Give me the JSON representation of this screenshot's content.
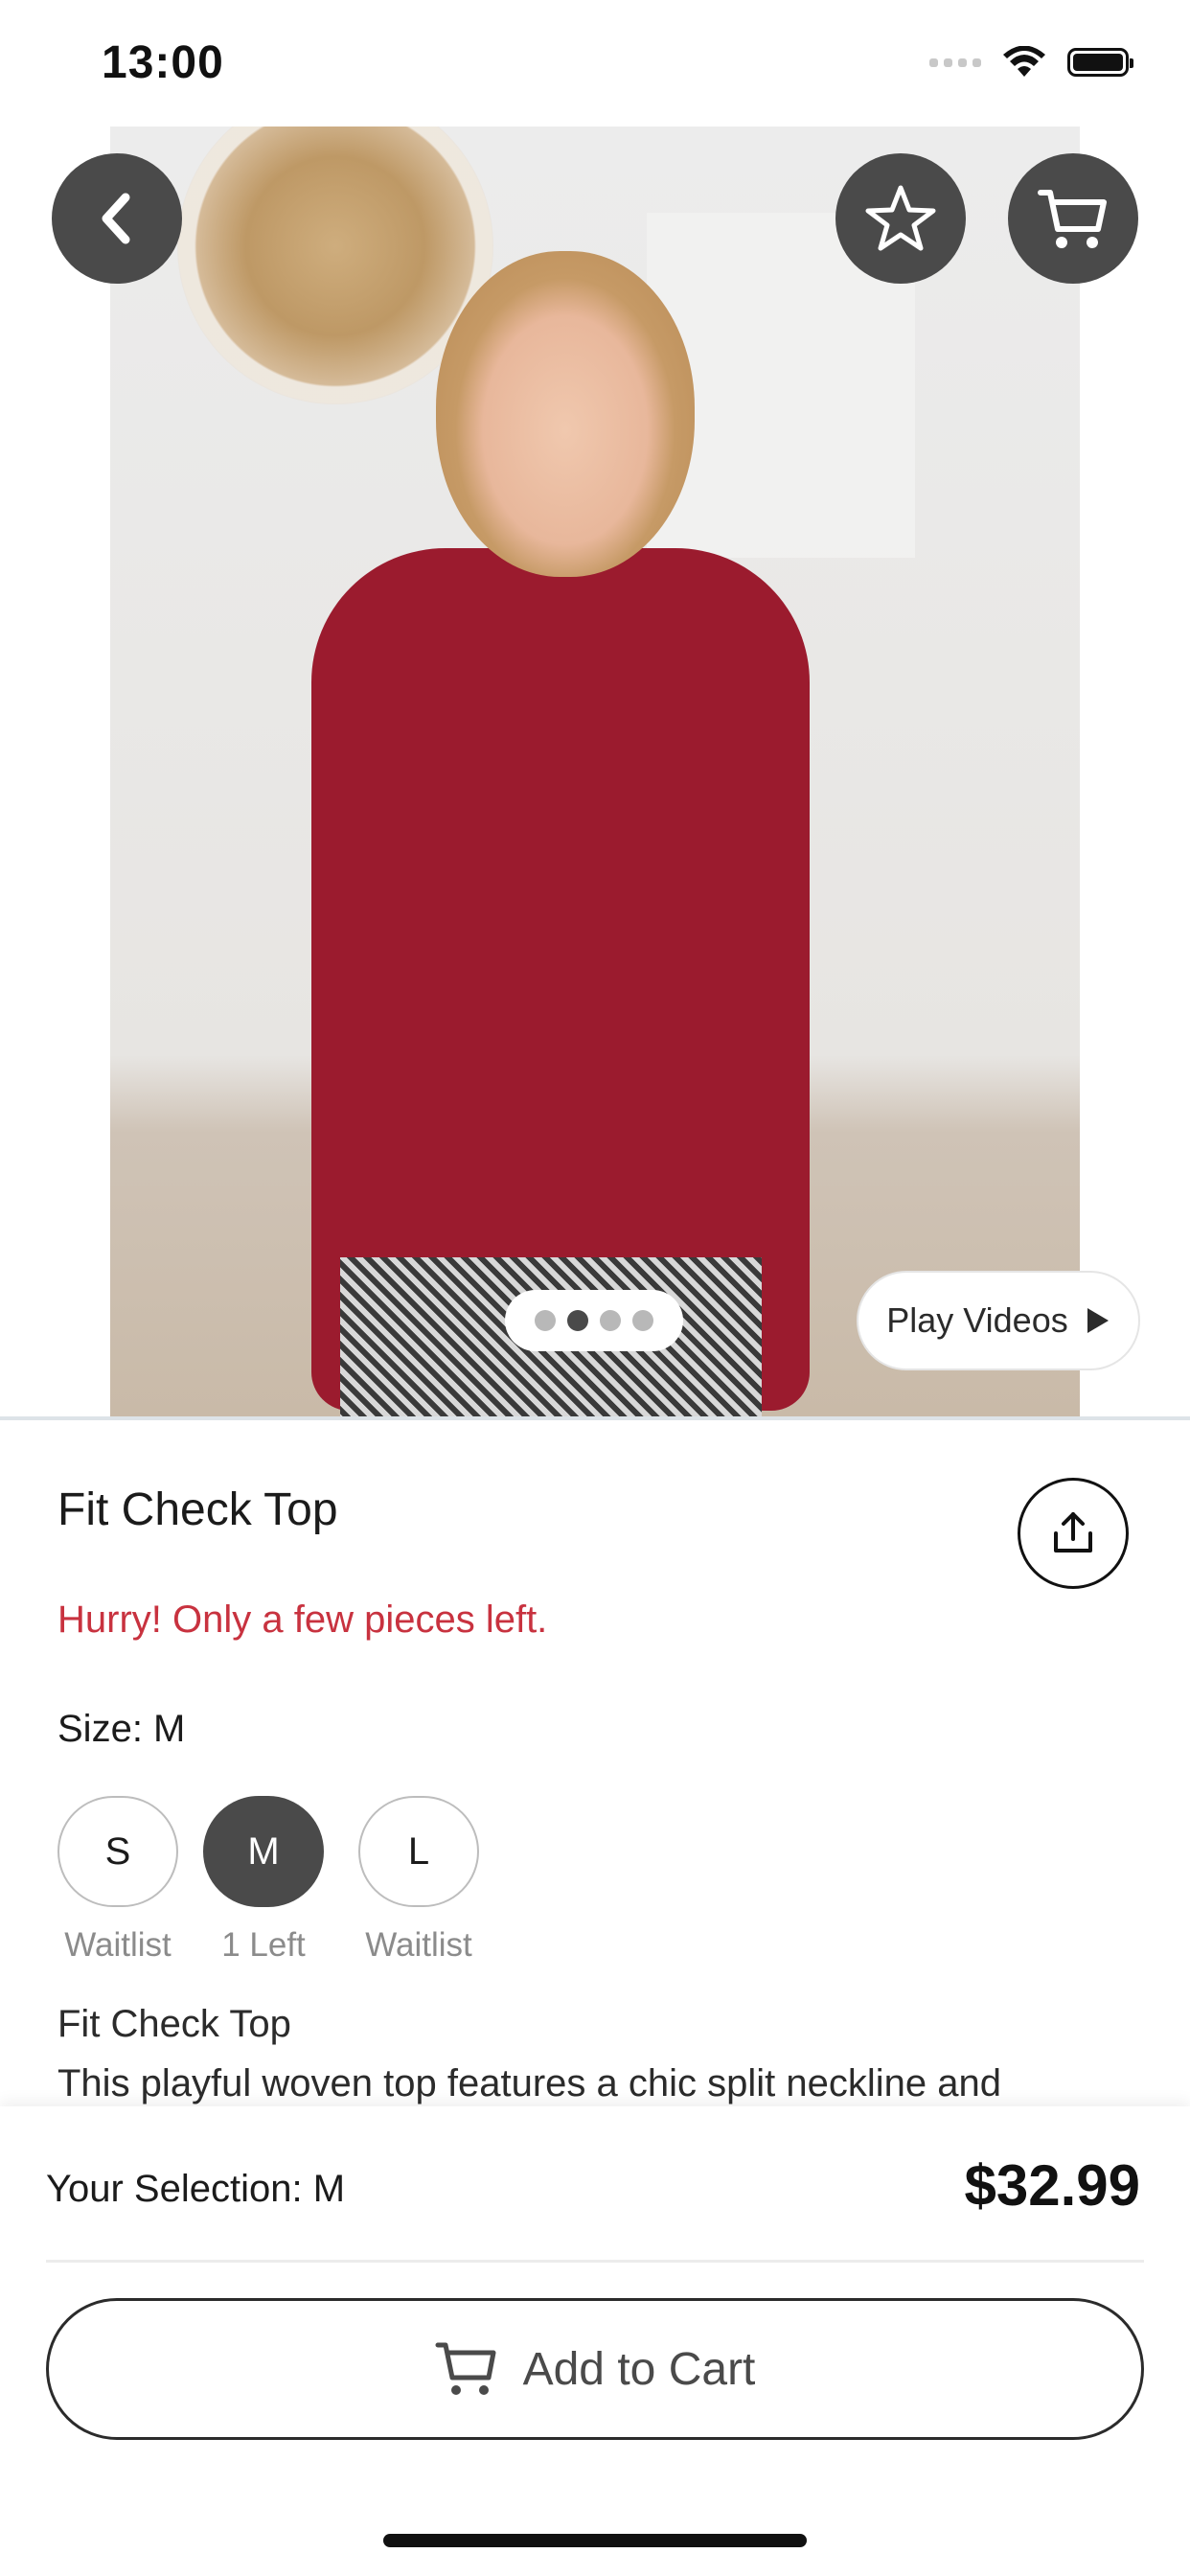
{
  "status_bar": {
    "time": "13:00"
  },
  "hero": {
    "image_alt": "Fit Check Top product photo",
    "play_videos_label": "Play Videos",
    "carousel_count": 4,
    "carousel_active_index": 1
  },
  "product": {
    "title": "Fit Check Top",
    "urgency": "Hurry! Only a few pieces left.",
    "size_label": "Size: M",
    "sizes": [
      {
        "label": "S",
        "note": "Waitlist"
      },
      {
        "label": "M",
        "note": "1 Left"
      },
      {
        "label": "L",
        "note": "Waitlist"
      }
    ],
    "description_title": "Fit Check Top",
    "description_text": "This playful woven top features a chic split neckline and"
  },
  "bottom_bar": {
    "selection": "Your Selection: M",
    "price": "$32.99",
    "add_to_cart_label": "Add to Cart"
  },
  "colors": {
    "urgency": "#c8323f",
    "button_dark": "#4a4a4a"
  },
  "icons": [
    "back-chevron-icon",
    "star-icon",
    "cart-icon",
    "share-icon",
    "play-icon",
    "wifi-icon",
    "battery-icon"
  ]
}
